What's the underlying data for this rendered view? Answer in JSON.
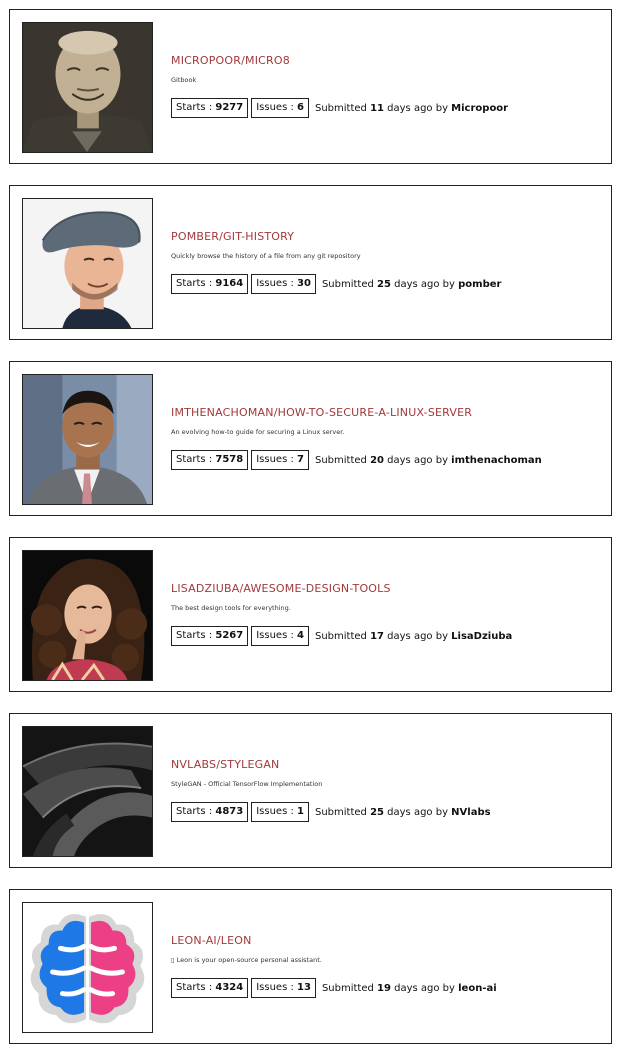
{
  "labels": {
    "starts": "Starts : ",
    "issues": "Issues : ",
    "submitted": "Submitted ",
    "days_ago_by": " days ago by "
  },
  "repos": [
    {
      "title": "MICROPOOR/MICRO8",
      "description": "Gitbook",
      "starts": "9277",
      "issues": "6",
      "days": "11",
      "author": "Micropoor",
      "avatar": "man-portrait-sepia"
    },
    {
      "title": "POMBER/GIT-HISTORY",
      "description": "Quickly browse the history of a file from any git repository",
      "starts": "9164",
      "issues": "30",
      "days": "25",
      "author": "pomber",
      "avatar": "man-in-flat-cap"
    },
    {
      "title": "IMTHENACHOMAN/HOW-TO-SECURE-A-LINUX-SERVER",
      "description": "An evolving how-to guide for securing a Linux server.",
      "starts": "7578",
      "issues": "7",
      "days": "20",
      "author": "imthenachoman",
      "avatar": "man-in-suit"
    },
    {
      "title": "LISADZIUBA/AWESOME-DESIGN-TOOLS",
      "description": "The best design tools for everything.",
      "starts": "5267",
      "issues": "4",
      "days": "17",
      "author": "LisaDziuba",
      "avatar": "woman-curly-hair"
    },
    {
      "title": "NVLABS/STYLEGAN",
      "description": "StyleGAN - Official TensorFlow Implementation",
      "starts": "4873",
      "issues": "1",
      "days": "25",
      "author": "NVlabs",
      "avatar": "nvidia-logo-dark"
    },
    {
      "title": "LEON-AI/LEON",
      "description": "▯ Leon is your open-source personal assistant.",
      "starts": "4324",
      "issues": "13",
      "days": "19",
      "author": "leon-ai",
      "avatar": "brain-logo"
    }
  ]
}
